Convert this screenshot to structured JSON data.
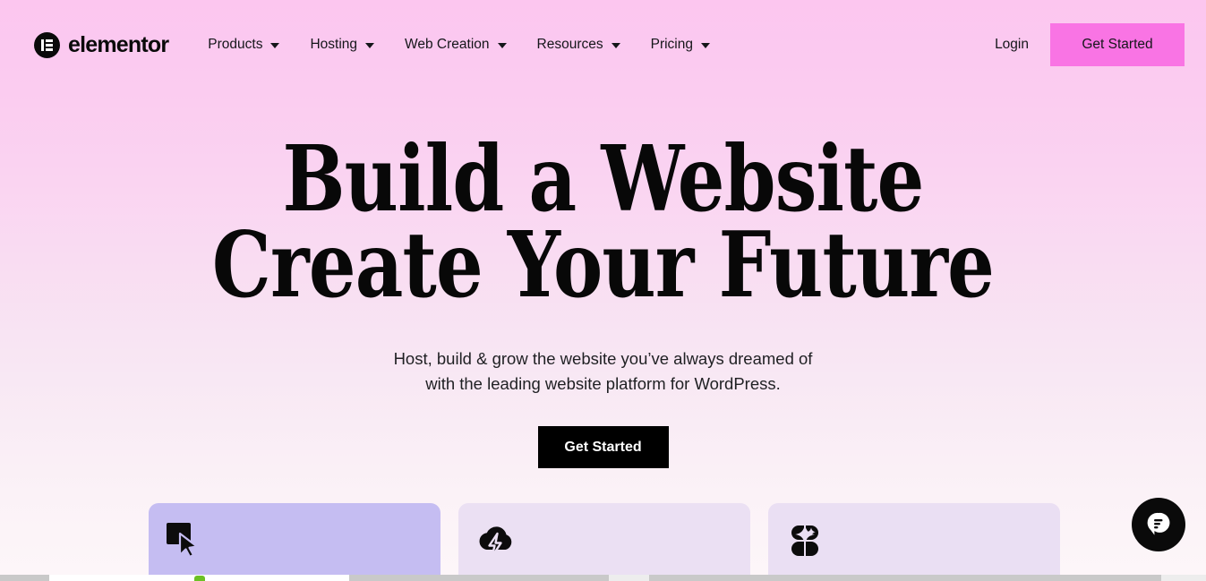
{
  "brand": {
    "name": "elementor",
    "logo_icon": "elementor-logo-icon"
  },
  "nav": {
    "items": [
      {
        "label": "Products",
        "caret_icon": "chevron-down-icon"
      },
      {
        "label": "Hosting",
        "caret_icon": "chevron-down-icon"
      },
      {
        "label": "Web Creation",
        "caret_icon": "chevron-down-icon"
      },
      {
        "label": "Resources",
        "caret_icon": "chevron-down-icon"
      },
      {
        "label": "Pricing",
        "caret_icon": "chevron-down-icon"
      }
    ],
    "login_label": "Login",
    "cta_label": "Get Started",
    "cta_color": "#f974e4"
  },
  "hero": {
    "title_line1": "Build a Website",
    "title_line2": "Create Your Future",
    "subtitle_line1": "Host, build & grow the website you’ve always dreamed of",
    "subtitle_line2": "with the leading website platform for WordPress.",
    "cta_label": "Get Started",
    "cta_bg": "#000000",
    "background_top": "#fcc6ef",
    "background_bottom": "#fdf6f9"
  },
  "cards": [
    {
      "icon": "website-builder-cursor-icon",
      "bg": "#c5bdf2"
    },
    {
      "icon": "cloud-lightning-icon",
      "bg": "#ebe0f3"
    },
    {
      "icon": "ai-sparkle-icon",
      "bg": "#eadff3"
    }
  ],
  "chat": {
    "icon": "chat-bubble-icon",
    "bg": "#0a0a0a"
  }
}
